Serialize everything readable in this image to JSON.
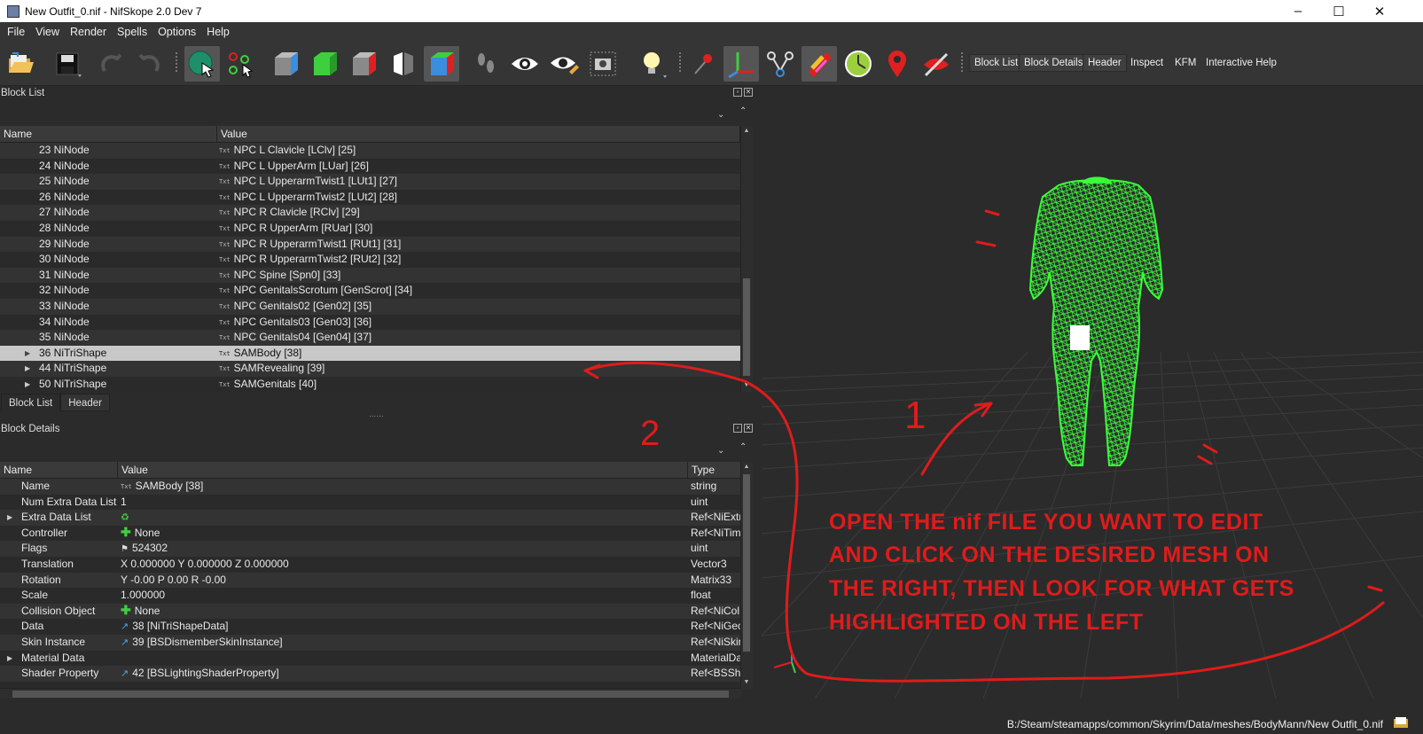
{
  "window": {
    "title": "New Outfit_0.nif - NifSkope 2.0 Dev 7",
    "controls": [
      "–",
      "☐",
      "✕"
    ]
  },
  "menu": [
    "File",
    "View",
    "Render",
    "Spells",
    "Options",
    "Help"
  ],
  "toolbar": {
    "text_buttons": [
      "Block List",
      "Block Details",
      "Header",
      "Inspect",
      "KFM",
      "Interactive Help"
    ]
  },
  "block_list": {
    "title": "Block List",
    "headers": {
      "name": "Name",
      "value": "Value"
    },
    "rows": [
      {
        "name": "23 NiNode",
        "value": "NPC L Clavicle [LClv] [25]"
      },
      {
        "name": "24 NiNode",
        "value": "NPC L UpperArm [LUar] [26]"
      },
      {
        "name": "25 NiNode",
        "value": "NPC L UpperarmTwist1 [LUt1] [27]"
      },
      {
        "name": "26 NiNode",
        "value": "NPC L UpperarmTwist2 [LUt2] [28]"
      },
      {
        "name": "27 NiNode",
        "value": "NPC R Clavicle [RClv] [29]"
      },
      {
        "name": "28 NiNode",
        "value": "NPC R UpperArm [RUar] [30]"
      },
      {
        "name": "29 NiNode",
        "value": "NPC R UpperarmTwist1 [RUt1] [31]"
      },
      {
        "name": "30 NiNode",
        "value": "NPC R UpperarmTwist2 [RUt2] [32]"
      },
      {
        "name": "31 NiNode",
        "value": "NPC Spine [Spn0] [33]"
      },
      {
        "name": "32 NiNode",
        "value": "NPC GenitalsScrotum [GenScrot] [34]"
      },
      {
        "name": "33 NiNode",
        "value": "NPC Genitals02 [Gen02] [35]"
      },
      {
        "name": "34 NiNode",
        "value": "NPC Genitals03 [Gen03] [36]"
      },
      {
        "name": "35 NiNode",
        "value": "NPC Genitals04 [Gen04] [37]"
      },
      {
        "name": "36 NiTriShape",
        "value": "SAMBody [38]"
      },
      {
        "name": "44 NiTriShape",
        "value": "SAMRevealing [39]"
      },
      {
        "name": "50 NiTriShape",
        "value": "SAMGenitals [40]"
      }
    ],
    "tabs": [
      "Block List",
      "Header"
    ],
    "splitter": "......"
  },
  "block_details": {
    "title": "Block Details",
    "headers": {
      "name": "Name",
      "value": "Value",
      "type": "Type"
    },
    "rows": [
      {
        "name": "Name",
        "value": "SAMBody [38]",
        "type": "string"
      },
      {
        "name": "Num Extra Data List",
        "value": "1",
        "type": "uint"
      },
      {
        "name": "Extra Data List",
        "value": "",
        "type": "Ref<NiExtr"
      },
      {
        "name": "Controller",
        "value": "None",
        "type": "Ref<NiTim"
      },
      {
        "name": "Flags",
        "value": "524302",
        "type": "uint"
      },
      {
        "name": "Translation",
        "value": "X 0.000000 Y 0.000000 Z 0.000000",
        "type": "Vector3"
      },
      {
        "name": "Rotation",
        "value": "Y -0.00 P 0.00 R -0.00",
        "type": "Matrix33"
      },
      {
        "name": "Scale",
        "value": "1.000000",
        "type": "float"
      },
      {
        "name": "Collision Object",
        "value": "None",
        "type": "Ref<NiCol"
      },
      {
        "name": "Data",
        "value": "38 [NiTriShapeData]",
        "type": "Ref<NiGec"
      },
      {
        "name": "Skin Instance",
        "value": "39 [BSDismemberSkinInstance]",
        "type": "Ref<NiSkir"
      },
      {
        "name": "Material Data",
        "value": "",
        "type": "MaterialDa"
      },
      {
        "name": "Shader Property",
        "value": "42 [BSLightingShaderProperty]",
        "type": "Ref<BSSha"
      }
    ]
  },
  "status": {
    "path": "B:/Steam/steamapps/common/Skyrim/Data/meshes/BodyMann/New Outfit_0.nif"
  },
  "annotation": {
    "lines": [
      "OPEN THE nif  FILE YOU WANT TO EDIT",
      "AND CLICK ON THE DESIRED MESH ON",
      "THE RIGHT, THEN LOOK FOR WHAT GETS",
      "HIGHLIGHTED ON THE LEFT"
    ],
    "label_1": "1",
    "label_2": "2",
    "color": "#e01b1b"
  },
  "colors": {
    "mesh": "#39ff39",
    "selection": "#c8c8c8",
    "panel_bg": "#2a2a2a"
  }
}
